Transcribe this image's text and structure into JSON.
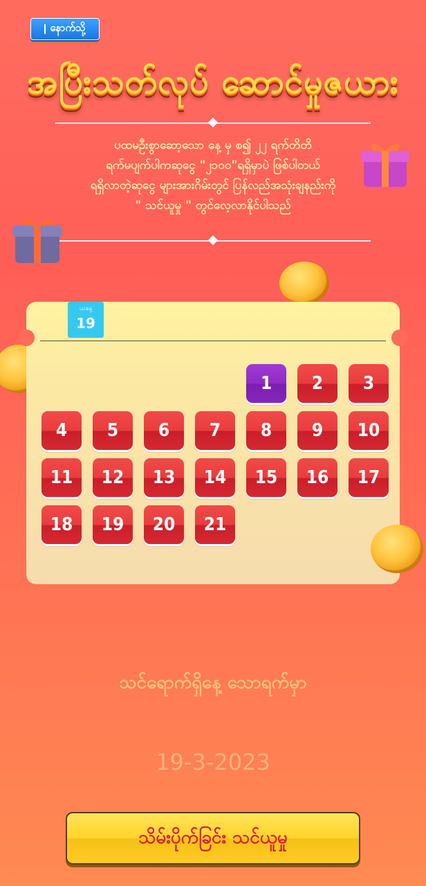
{
  "header": {
    "back_label": "နောက်သို့",
    "title": "အပြီးသတ်လုပ် ဆောင်မှုဇယား"
  },
  "description": {
    "lines": [
      "ပထမဦးစွာဆော့သော နေ့ မှ စ၍ ၂၂ ရက်တိတိ",
      "ရက်မပျက်ပါကဆုငွေ \"၂၁၀၀\"ရရှိမှာပဲ ဖြစ်ပါတယ်",
      "ရရှိလာတဲ့ဆုငွေ များအားဂိမ်းတွင် ပြန်လည်အသုံးချနည်းကို",
      "\" သင်ယူမှု \" တွင်လေ့လာနိုင်ပါသည်"
    ]
  },
  "calendar": {
    "badge_label": "ယနေ့",
    "badge_day": "19",
    "days": [
      "1",
      "2",
      "3",
      "4",
      "5",
      "6",
      "7",
      "8",
      "9",
      "10",
      "11",
      "12",
      "13",
      "14",
      "15",
      "16",
      "17",
      "18",
      "19",
      "20",
      "21"
    ],
    "active_day": "1"
  },
  "footer": {
    "message": "သင်ရောက်ရှိနေ့ သောရက်မှာ",
    "date": "19-3-2023",
    "claim_label": "သိမ်းပိုက်ခြင်း သင်ယူမှု"
  },
  "colors": {
    "background": "#ff6d5f",
    "cell": "#ea3c3c",
    "active_cell": "#8e2cc4",
    "badge": "#36c9f0",
    "button": "#ffd428"
  }
}
